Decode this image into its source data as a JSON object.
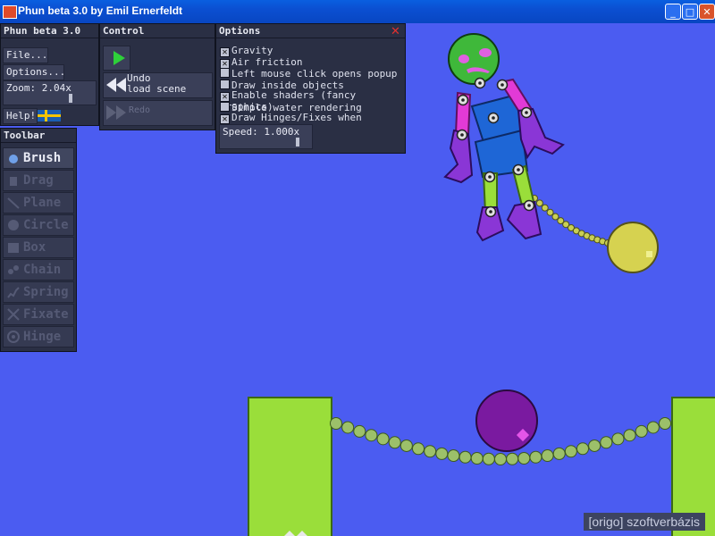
{
  "window": {
    "title": "Phun beta 3.0 by Emil Ernerfeldt",
    "min_label": "_",
    "max_label": "□",
    "close_label": "✕"
  },
  "main_panel": {
    "title": "Phun beta 3.0",
    "file_label": "File...",
    "options_label": "Options...",
    "zoom_label": "Zoom: 2.04x",
    "help_label": "Help!"
  },
  "control": {
    "title": "Control",
    "undo_label_1": "Undo",
    "undo_label_2": "load scene",
    "redo_label": "Redo"
  },
  "options": {
    "title": "Options",
    "items": [
      {
        "label": "Gravity",
        "checked": true
      },
      {
        "label": "Air friction",
        "checked": true
      },
      {
        "label": "Left mouse click opens popup",
        "checked": false
      },
      {
        "label": "Draw inside objects",
        "checked": false
      },
      {
        "label": "Enable shaders (fancy graphics)",
        "checked": true
      },
      {
        "label": "Simple water rendering",
        "checked": false
      },
      {
        "label": "Draw Hinges/Fixes when running",
        "checked": true
      }
    ],
    "speed_label": "Speed: 1.000x"
  },
  "toolbar": {
    "title": "Toolbar",
    "tools": [
      {
        "label": "Brush",
        "icon": "brush-icon",
        "active": true
      },
      {
        "label": "Drag",
        "icon": "drag-icon",
        "active": false
      },
      {
        "label": "Plane",
        "icon": "plane-icon",
        "active": false
      },
      {
        "label": "Circle",
        "icon": "circle-icon",
        "active": false
      },
      {
        "label": "Box",
        "icon": "box-icon",
        "active": false
      },
      {
        "label": "Chain",
        "icon": "chain-icon",
        "active": false
      },
      {
        "label": "Spring",
        "icon": "spring-icon",
        "active": false
      },
      {
        "label": "Fixate",
        "icon": "fixate-icon",
        "active": false
      },
      {
        "label": "Hinge",
        "icon": "hinge-icon",
        "active": false
      }
    ]
  },
  "watermark": "[origo] szoftverbázis",
  "colors": {
    "background": "#4b5cf1",
    "green": "#9ade3a",
    "purple": "#7a1aa0",
    "yellow": "#d6d250"
  }
}
